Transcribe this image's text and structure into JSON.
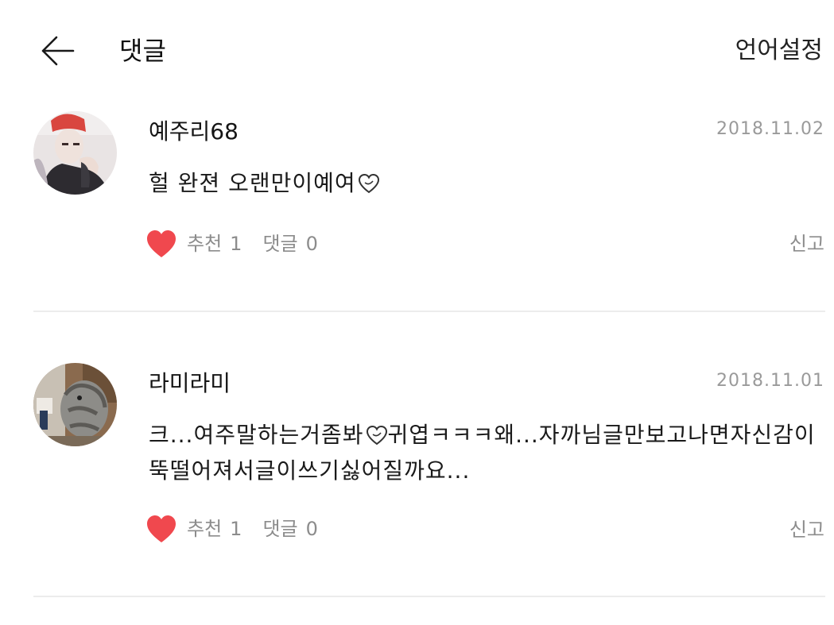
{
  "header": {
    "back_icon": "arrow-left-icon",
    "title": "댓글",
    "language_button": "언어설정"
  },
  "comments": [
    {
      "author": "예주리68",
      "date": "2018.11.02",
      "text": "헐 완젼 오랜만이예여",
      "text_emoji": "purple-heart-outline-icon",
      "like_icon": "heart-icon",
      "like_label": "추천",
      "like_count": "1",
      "reply_label": "댓글",
      "reply_count": "0",
      "report_label": "신고"
    },
    {
      "author": "라미라미",
      "date": "2018.11.01",
      "text_before_emoji": "크...여주말하는거좀봐",
      "text_emoji": "purple-heart-outline-icon",
      "text_after_emoji": "귀엽ㅋㅋㅋ왜...자까님글만보고나면자신감이뚝떨어져서글이쓰기싫어질까요...",
      "like_icon": "heart-icon",
      "like_label": "추천",
      "like_count": "1",
      "reply_label": "댓글",
      "reply_count": "0",
      "report_label": "신고"
    }
  ],
  "colors": {
    "heart": "#f0484e",
    "muted_text": "#8c8c8c",
    "date_text": "#9a9a9a",
    "divider": "#ececec"
  }
}
